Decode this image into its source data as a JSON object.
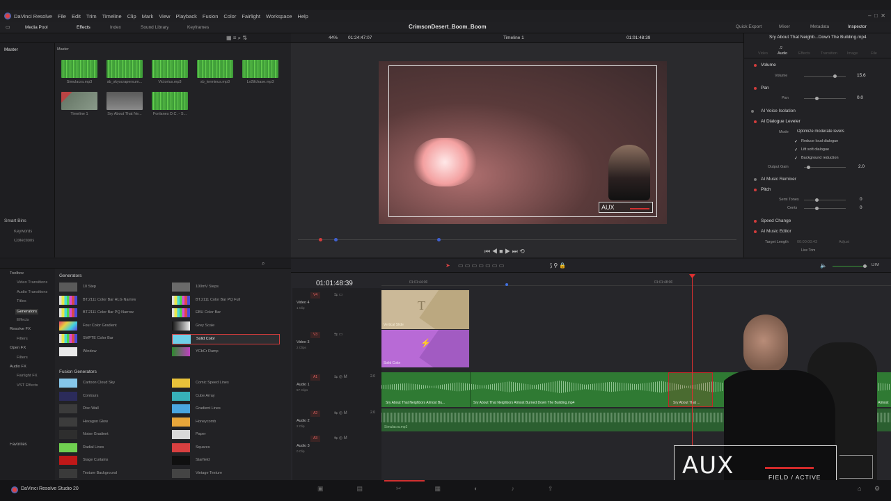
{
  "app": {
    "menu": [
      "DaVinci Resolve",
      "File",
      "Edit",
      "Trim",
      "Timeline",
      "Clip",
      "Mark",
      "View",
      "Playback",
      "Fusion",
      "Color",
      "Fairlight",
      "Workspace",
      "Help"
    ],
    "project_title": "CrimsonDesert_Boom_Boom",
    "right_tools": [
      "Quick Export",
      "Mixer",
      "Metadata",
      "Inspector"
    ]
  },
  "toolbar": {
    "left": [
      "Media Pool",
      "Effects",
      "Index",
      "Sound Library",
      "Keyframes"
    ],
    "zoom": "44%",
    "source_tc": "01:24:47:07",
    "timeline_name": "Timeline 1",
    "record_tc": "01:01:48:39",
    "clip_name": "Sry About That Neighb...Down The Building.mp4"
  },
  "mediapool": {
    "master_label": "Master",
    "header": "Master",
    "clips": [
      {
        "name": "Simulacra.mp3",
        "type": "audio"
      },
      {
        "name": "sb_skyscrapersum...",
        "type": "audio"
      },
      {
        "name": "Victorius.mp3",
        "type": "audio"
      },
      {
        "name": "sb_terminus.mp3",
        "type": "audio"
      },
      {
        "name": "Lv2tfchase.mp3",
        "type": "audio"
      },
      {
        "name": "Timeline 1",
        "type": "timeline"
      },
      {
        "name": "Sry About That Ne...",
        "type": "video"
      },
      {
        "name": "Fonlanes D.C. - S...",
        "type": "audio"
      }
    ],
    "smart_bins": "Smart Bins",
    "smart_items": [
      "Keywords",
      "Collections"
    ]
  },
  "viewer": {
    "aux_label": "AUX"
  },
  "inspector": {
    "tabs": [
      "Video",
      "Audio",
      "Effects",
      "Transition",
      "Image",
      "File"
    ],
    "active_tab": "Audio",
    "sections": {
      "volume": {
        "title": "Volume",
        "param": "Volume",
        "value": "15.6"
      },
      "pan": {
        "title": "Pan",
        "param": "Pan",
        "value": "0.0"
      },
      "voice_iso": "AI Voice Isolation",
      "dialogue": {
        "title": "AI Dialogue Leveler",
        "mode_label": "Mode",
        "mode_value": "Optimize moderate levels",
        "checks": [
          "Reduce loud dialogue",
          "Lift soft dialogue",
          "Background reduction"
        ],
        "gain_label": "Output Gain",
        "gain_value": "2.0"
      },
      "music_remixer": "AI Music Remixer",
      "pitch": {
        "title": "Pitch",
        "semi_label": "Semi Tones",
        "semi_value": "0",
        "cents_label": "Cents",
        "cents_value": "0"
      },
      "speed": "Speed Change",
      "music_editor": {
        "title": "AI Music Editor",
        "target_label": "Target Length",
        "target_value": "00:00:00:43",
        "adjust": "Adjust",
        "live_trim": "Live Trim"
      }
    }
  },
  "effects": {
    "categories": [
      {
        "label": "Toolbox",
        "level": 0
      },
      {
        "label": "Video Transitions",
        "level": 1
      },
      {
        "label": "Audio Transitions",
        "level": 1
      },
      {
        "label": "Titles",
        "level": 1
      },
      {
        "label": "Generators",
        "level": 1,
        "active": true
      },
      {
        "label": "Effects",
        "level": 1
      },
      {
        "label": "Resolve FX",
        "level": 0
      },
      {
        "label": "Filters",
        "level": 1
      },
      {
        "label": "Open FX",
        "level": 0
      },
      {
        "label": "Filters",
        "level": 1
      },
      {
        "label": "Audio FX",
        "level": 0
      },
      {
        "label": "Fairlight FX",
        "level": 1
      },
      {
        "label": "VST Effects",
        "level": 1
      }
    ],
    "favorites": "Favorites",
    "generators_title": "Generators",
    "generators": [
      {
        "name": "10 Step",
        "c": "#5a5a5a"
      },
      {
        "name": "100mV Steps",
        "c": "#6a6a6a"
      },
      {
        "name": "BT.2111 Color Bar HLG Narrow",
        "c": "bars"
      },
      {
        "name": "BT.2111 Color Bar PQ Full",
        "c": "bars"
      },
      {
        "name": "BT.2111 Color Bar PQ Narrow",
        "c": "bars"
      },
      {
        "name": "EBU Color Bar",
        "c": "bars"
      },
      {
        "name": "Four Color Gradient",
        "c": "grad4"
      },
      {
        "name": "Grey Scale",
        "c": "greyscale"
      },
      {
        "name": "SMPTE Color Bar",
        "c": "bars"
      },
      {
        "name": "Solid Color",
        "c": "#6fcfe8",
        "selected": true
      },
      {
        "name": "Window",
        "c": "#e9e9e9"
      },
      {
        "name": "YCbCr Ramp",
        "c": "ycbcr"
      }
    ],
    "fusion_title": "Fusion Generators",
    "fusion": [
      {
        "name": "Cartoon Cloud Sky",
        "c": "#86c7ea"
      },
      {
        "name": "Comic Speed Lines",
        "c": "#e8c23a"
      },
      {
        "name": "Contours",
        "c": "#2b2b5a"
      },
      {
        "name": "Cube Array",
        "c": "#37b0b8"
      },
      {
        "name": "Disc Wall",
        "c": "#3b3b3b"
      },
      {
        "name": "Gradient Lines",
        "c": "#4aa6e0"
      },
      {
        "name": "Hexagon Glow",
        "c": "#3c3c3c"
      },
      {
        "name": "Honeycomb",
        "c": "#e8a63a"
      },
      {
        "name": "Noise Gradient",
        "c": "#2e2e2e"
      },
      {
        "name": "Paper",
        "c": "#d8d8d8"
      },
      {
        "name": "Radial Lines",
        "c": "#70d050"
      },
      {
        "name": "Squares",
        "c": "#d84040"
      },
      {
        "name": "Stage Curtains",
        "c": "#c01818"
      },
      {
        "name": "Starfield",
        "c": "#101010"
      },
      {
        "name": "Texture Background",
        "c": "#3a3a3a"
      },
      {
        "name": "Vintage Texture",
        "c": "#444"
      }
    ]
  },
  "timeline": {
    "timecode": "01:01:48:39",
    "ruler": [
      "01:01:44:00",
      "01:01:48:00"
    ],
    "tracks": [
      {
        "id": "V4",
        "name": "Video 4",
        "clips": "1 Clip"
      },
      {
        "id": "V3",
        "name": "Video 3",
        "clips": "2 Clips"
      },
      {
        "id": "A1",
        "name": "Audio 1",
        "clips": "57 Clips",
        "level": "2.0"
      },
      {
        "id": "A2",
        "name": "Audio 2",
        "clips": "2 Clip",
        "level": "2.0"
      },
      {
        "id": "A3",
        "name": "Audio 3",
        "clips": "0 Clip"
      }
    ],
    "clip_v4": "Vertical Slide",
    "clip_v3": "Solid Color",
    "audio_clips": [
      "Sry About That Neighbors Almost Bu...",
      "Sry About That Neighbors Almost Burned Down The Building.mp4",
      "Sry About That ...",
      "Sry About That Neighbors Almost Burned Dow..."
    ],
    "audio2_clip": "Simulacra.mp3",
    "dim": "DIM"
  },
  "overlay": {
    "aux": "AUX",
    "status": "FIELD / ACTIVE"
  },
  "footer": {
    "brand": "DaVinci Resolve Studio 20"
  }
}
